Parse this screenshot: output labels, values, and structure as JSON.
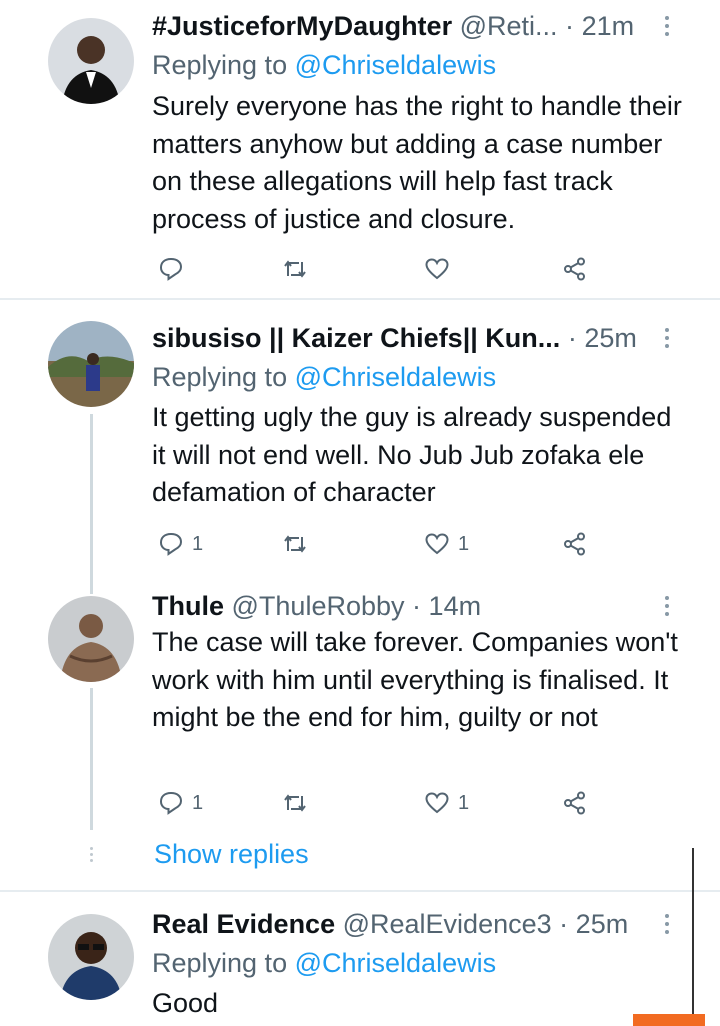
{
  "tweets": [
    {
      "name": "#JusticeforMyDaughter",
      "handle": "@Reti...",
      "dot": "·",
      "time": "21m",
      "replying_prefix": "Replying to",
      "replying_to": "@Chriseldalewis",
      "text": "Surely everyone has the right to handle their matters anyhow but adding a case number on these allegations will help fast track process of justice and closure.",
      "reply_count": "",
      "retweet_count": "",
      "like_count": ""
    },
    {
      "name": "sibusiso || Kaizer Chiefs|| Kun...",
      "handle": "",
      "dot": "·",
      "time": "25m",
      "replying_prefix": "Replying to",
      "replying_to": "@Chriseldalewis",
      "text": "It getting ugly the guy is already suspended it will not end well. No Jub Jub zofaka ele defamation of character",
      "reply_count": "1",
      "retweet_count": "",
      "like_count": "1"
    },
    {
      "name": "Thule",
      "handle": "@ThuleRobby",
      "dot": "·",
      "time": "14m",
      "text": "The case will take forever. Companies won't work with him until everything is finalised. It might be the end for him, guilty or not",
      "reply_count": "1",
      "retweet_count": "",
      "like_count": "1"
    },
    {
      "name": "Real Evidence",
      "handle": "@RealEvidence3",
      "dot": "·",
      "time": "25m",
      "replying_prefix": "Replying to",
      "replying_to": "@Chriseldalewis",
      "text": "Good"
    }
  ],
  "show_replies": "Show replies",
  "colors": {
    "link": "#1d9bf0",
    "secondary": "#536471",
    "accent_bar": "#f26b21"
  },
  "icons": [
    "reply-icon",
    "retweet-icon",
    "like-icon",
    "share-icon",
    "more-icon"
  ]
}
